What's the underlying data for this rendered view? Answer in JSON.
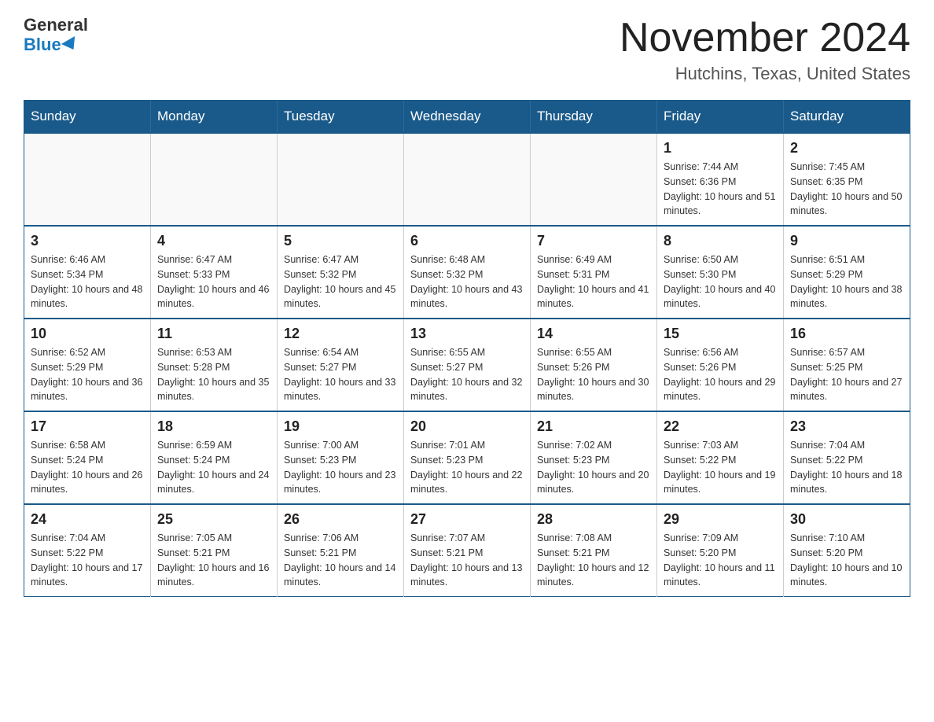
{
  "logo": {
    "general": "General",
    "blue": "Blue"
  },
  "calendar": {
    "title": "November 2024",
    "subtitle": "Hutchins, Texas, United States"
  },
  "days_of_week": [
    "Sunday",
    "Monday",
    "Tuesday",
    "Wednesday",
    "Thursday",
    "Friday",
    "Saturday"
  ],
  "weeks": [
    [
      {
        "day": "",
        "info": ""
      },
      {
        "day": "",
        "info": ""
      },
      {
        "day": "",
        "info": ""
      },
      {
        "day": "",
        "info": ""
      },
      {
        "day": "",
        "info": ""
      },
      {
        "day": "1",
        "info": "Sunrise: 7:44 AM\nSunset: 6:36 PM\nDaylight: 10 hours and 51 minutes."
      },
      {
        "day": "2",
        "info": "Sunrise: 7:45 AM\nSunset: 6:35 PM\nDaylight: 10 hours and 50 minutes."
      }
    ],
    [
      {
        "day": "3",
        "info": "Sunrise: 6:46 AM\nSunset: 5:34 PM\nDaylight: 10 hours and 48 minutes."
      },
      {
        "day": "4",
        "info": "Sunrise: 6:47 AM\nSunset: 5:33 PM\nDaylight: 10 hours and 46 minutes."
      },
      {
        "day": "5",
        "info": "Sunrise: 6:47 AM\nSunset: 5:32 PM\nDaylight: 10 hours and 45 minutes."
      },
      {
        "day": "6",
        "info": "Sunrise: 6:48 AM\nSunset: 5:32 PM\nDaylight: 10 hours and 43 minutes."
      },
      {
        "day": "7",
        "info": "Sunrise: 6:49 AM\nSunset: 5:31 PM\nDaylight: 10 hours and 41 minutes."
      },
      {
        "day": "8",
        "info": "Sunrise: 6:50 AM\nSunset: 5:30 PM\nDaylight: 10 hours and 40 minutes."
      },
      {
        "day": "9",
        "info": "Sunrise: 6:51 AM\nSunset: 5:29 PM\nDaylight: 10 hours and 38 minutes."
      }
    ],
    [
      {
        "day": "10",
        "info": "Sunrise: 6:52 AM\nSunset: 5:29 PM\nDaylight: 10 hours and 36 minutes."
      },
      {
        "day": "11",
        "info": "Sunrise: 6:53 AM\nSunset: 5:28 PM\nDaylight: 10 hours and 35 minutes."
      },
      {
        "day": "12",
        "info": "Sunrise: 6:54 AM\nSunset: 5:27 PM\nDaylight: 10 hours and 33 minutes."
      },
      {
        "day": "13",
        "info": "Sunrise: 6:55 AM\nSunset: 5:27 PM\nDaylight: 10 hours and 32 minutes."
      },
      {
        "day": "14",
        "info": "Sunrise: 6:55 AM\nSunset: 5:26 PM\nDaylight: 10 hours and 30 minutes."
      },
      {
        "day": "15",
        "info": "Sunrise: 6:56 AM\nSunset: 5:26 PM\nDaylight: 10 hours and 29 minutes."
      },
      {
        "day": "16",
        "info": "Sunrise: 6:57 AM\nSunset: 5:25 PM\nDaylight: 10 hours and 27 minutes."
      }
    ],
    [
      {
        "day": "17",
        "info": "Sunrise: 6:58 AM\nSunset: 5:24 PM\nDaylight: 10 hours and 26 minutes."
      },
      {
        "day": "18",
        "info": "Sunrise: 6:59 AM\nSunset: 5:24 PM\nDaylight: 10 hours and 24 minutes."
      },
      {
        "day": "19",
        "info": "Sunrise: 7:00 AM\nSunset: 5:23 PM\nDaylight: 10 hours and 23 minutes."
      },
      {
        "day": "20",
        "info": "Sunrise: 7:01 AM\nSunset: 5:23 PM\nDaylight: 10 hours and 22 minutes."
      },
      {
        "day": "21",
        "info": "Sunrise: 7:02 AM\nSunset: 5:23 PM\nDaylight: 10 hours and 20 minutes."
      },
      {
        "day": "22",
        "info": "Sunrise: 7:03 AM\nSunset: 5:22 PM\nDaylight: 10 hours and 19 minutes."
      },
      {
        "day": "23",
        "info": "Sunrise: 7:04 AM\nSunset: 5:22 PM\nDaylight: 10 hours and 18 minutes."
      }
    ],
    [
      {
        "day": "24",
        "info": "Sunrise: 7:04 AM\nSunset: 5:22 PM\nDaylight: 10 hours and 17 minutes."
      },
      {
        "day": "25",
        "info": "Sunrise: 7:05 AM\nSunset: 5:21 PM\nDaylight: 10 hours and 16 minutes."
      },
      {
        "day": "26",
        "info": "Sunrise: 7:06 AM\nSunset: 5:21 PM\nDaylight: 10 hours and 14 minutes."
      },
      {
        "day": "27",
        "info": "Sunrise: 7:07 AM\nSunset: 5:21 PM\nDaylight: 10 hours and 13 minutes."
      },
      {
        "day": "28",
        "info": "Sunrise: 7:08 AM\nSunset: 5:21 PM\nDaylight: 10 hours and 12 minutes."
      },
      {
        "day": "29",
        "info": "Sunrise: 7:09 AM\nSunset: 5:20 PM\nDaylight: 10 hours and 11 minutes."
      },
      {
        "day": "30",
        "info": "Sunrise: 7:10 AM\nSunset: 5:20 PM\nDaylight: 10 hours and 10 minutes."
      }
    ]
  ]
}
